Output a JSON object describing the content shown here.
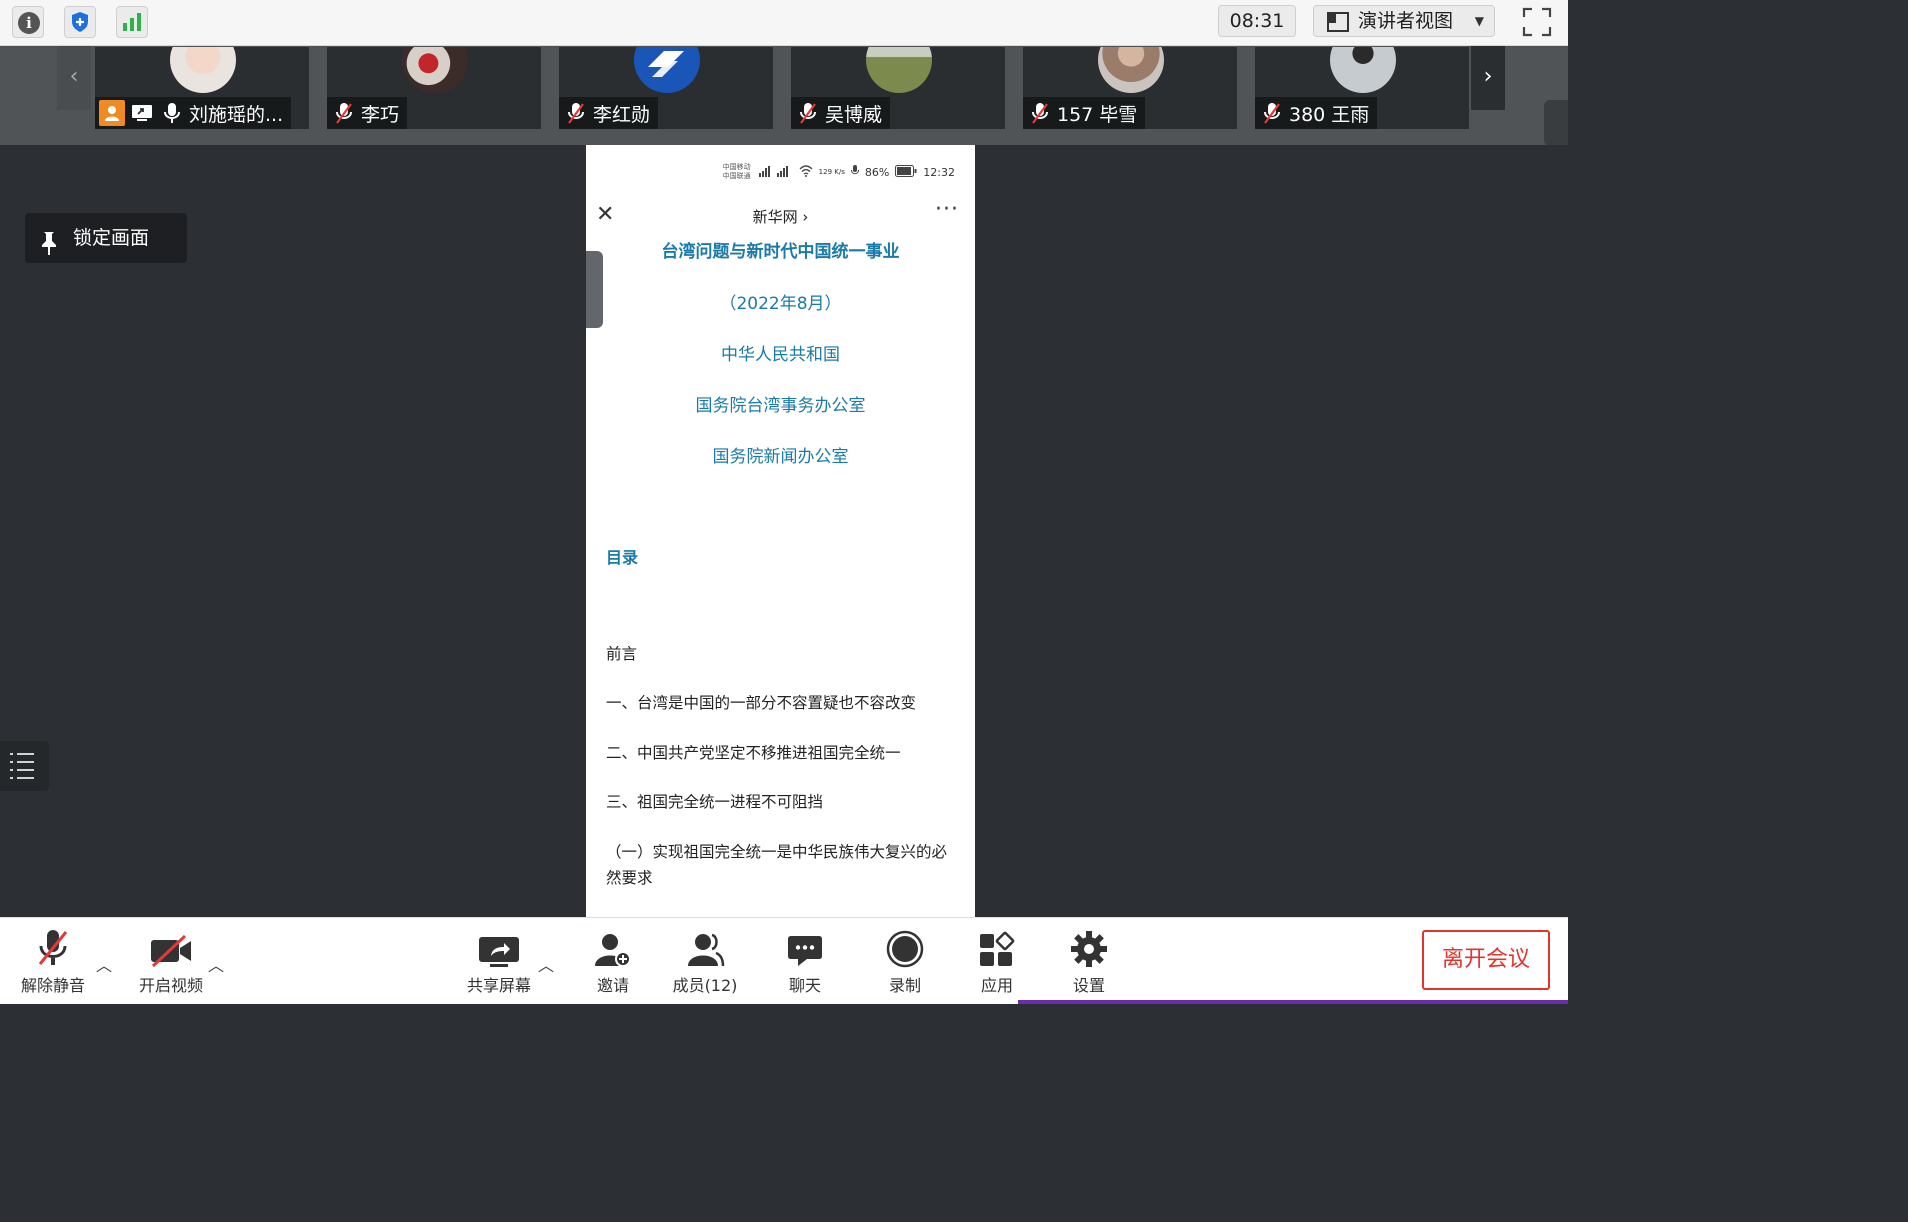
{
  "topbar": {
    "timer": "08:31",
    "view_mode": "演讲者视图"
  },
  "participants": [
    {
      "name": "刘施瑶的...",
      "muted": false,
      "host": true,
      "sharing": true
    },
    {
      "name": "李巧",
      "muted": true
    },
    {
      "name": "李红勋",
      "muted": true
    },
    {
      "name": "吴博威",
      "muted": true
    },
    {
      "name": "157 毕雪",
      "muted": true
    },
    {
      "name": "380 王雨",
      "muted": true
    }
  ],
  "stage": {
    "pin_label": "锁定画面"
  },
  "phone": {
    "status": {
      "carrier1": "中国移动",
      "carrier2": "中国联通",
      "speed": "129 K/s",
      "battery": "86%",
      "time": "12:32"
    },
    "site": "新华网 ›",
    "title": "台湾问题与新时代中国统一事业",
    "date": "（2022年8月）",
    "issuer1": "中华人民共和国",
    "issuer2": "国务院台湾事务办公室",
    "issuer3": "国务院新闻办公室",
    "toc_heading": "目录",
    "toc": [
      "前言",
      "一、台湾是中国的一部分不容置疑也不容改变",
      "二、中国共产党坚定不移推进祖国完全统一",
      "三、祖国完全统一进程不可阻挡",
      "（一）实现祖国完全统一是中华民族伟大复兴的必然要求"
    ]
  },
  "toolbar": {
    "unmute": "解除静音",
    "video": "开启视频",
    "share": "共享屏幕",
    "invite": "邀请",
    "members": "成员(12)",
    "chat": "聊天",
    "record": "录制",
    "apps": "应用",
    "settings": "设置",
    "leave": "离开会议"
  }
}
